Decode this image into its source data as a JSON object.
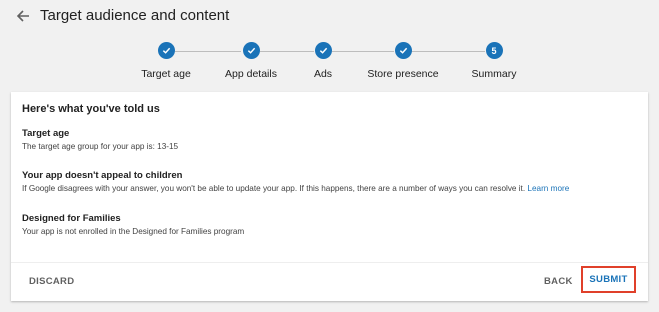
{
  "header": {
    "title": "Target audience and content"
  },
  "stepper": {
    "steps": [
      {
        "label": "Target age",
        "status": "complete",
        "icon": "check-icon"
      },
      {
        "label": "App details",
        "status": "complete",
        "icon": "check-icon"
      },
      {
        "label": "Ads",
        "status": "complete",
        "icon": "check-icon"
      },
      {
        "label": "Store presence",
        "status": "complete",
        "icon": "check-icon"
      },
      {
        "label": "Summary",
        "status": "current",
        "number": "5"
      }
    ]
  },
  "card": {
    "title": "Here's what you've told us",
    "sections": [
      {
        "heading": "Target age",
        "text": "The target age group for your app is: 13-15"
      },
      {
        "heading": "Your app doesn't appeal to children",
        "text": "If Google disagrees with your answer, you won't be able to update your app. If this happens, there are a number of ways you can resolve it.",
        "link": "Learn more"
      },
      {
        "heading": "Designed for Families",
        "text": "Your app is not enrolled in the Designed for Families program"
      }
    ]
  },
  "footer": {
    "discard_label": "DISCARD",
    "back_label": "BACK",
    "submit_label": "SUBMIT"
  },
  "colors": {
    "accent": "#1a73b8",
    "highlight_border": "#e0402a",
    "background": "#f1f1f1"
  }
}
